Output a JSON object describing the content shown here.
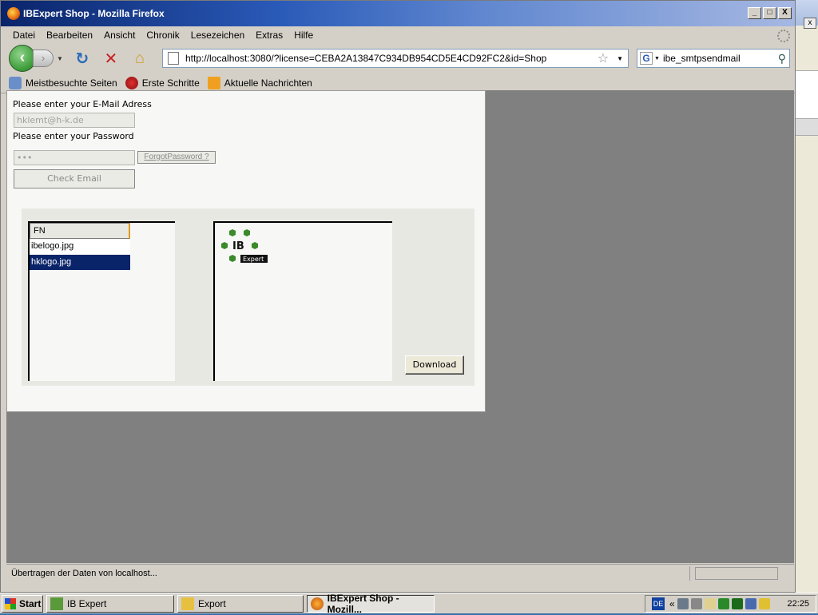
{
  "window": {
    "title": "IBExpert Shop - Mozilla Firefox",
    "controls": [
      "_",
      "□",
      "X"
    ]
  },
  "menu": [
    "Datei",
    "Bearbeiten",
    "Ansicht",
    "Chronik",
    "Lesezeichen",
    "Extras",
    "Hilfe"
  ],
  "nav": {
    "url": "http://localhost:3080/?license=CEBA2A13847C934DB954CD5E4CD92FC2&id=Shop",
    "search_value": "ibe_smtpsendmail"
  },
  "bookmarks": [
    "Meistbesuchte Seiten",
    "Erste Schritte",
    "Aktuelle Nachrichten"
  ],
  "page": {
    "email_label": "Please enter your E-Mail Adress",
    "email_value": "hklemt@h-k.de",
    "password_label": "Please enter your Password",
    "password_value": "•••",
    "forgot_label": "ForgotPassword ?",
    "check_label": "Check Email",
    "list_header": "FN",
    "files": [
      "ibelogo.jpg",
      "hklogo.jpg"
    ],
    "selected_file": "hklogo.jpg",
    "logo_text_main": "IB",
    "logo_text_sub": "Expert",
    "download_label": "Download"
  },
  "status": {
    "text": "Übertragen der Daten von localhost..."
  },
  "taskbar": {
    "start_label": "Start",
    "tasks": [
      "IB Expert",
      "Export",
      "IBExpert Shop - Mozill..."
    ],
    "lang": "DE",
    "time": "22:25"
  }
}
